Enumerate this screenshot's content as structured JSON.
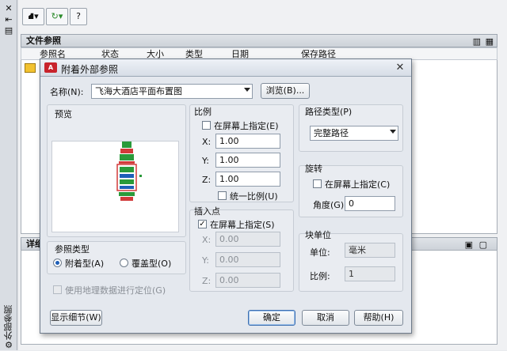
{
  "palette": {
    "title": "外部参照",
    "toolbar": {
      "attach_glyph": "⛘▾",
      "refresh_glyph": "↻▾",
      "help_glyph": "?"
    },
    "file_refs_header": "文件参照",
    "columns": [
      "参照名",
      "状态",
      "大小",
      "类型",
      "日期",
      "保存路径"
    ],
    "details_header": "详细"
  },
  "dialog": {
    "app_badge": "A",
    "title": "附着外部参照",
    "name_label": "名称(N):",
    "name_value": "飞海大酒店平面布置图",
    "browse_label": "浏览(B)...",
    "preview_label": "预览",
    "ref_type": {
      "label": "参照类型",
      "attach_label": "附着型(A)",
      "overlay_label": "覆盖型(O)"
    },
    "geo_label": "使用地理数据进行定位(G)",
    "scale": {
      "label": "比例",
      "onscreen_label": "在屏幕上指定(E)",
      "x_label": "X:",
      "x_value": "1.00",
      "y_label": "Y:",
      "y_value": "1.00",
      "z_label": "Z:",
      "z_value": "1.00",
      "uniform_label": "统一比例(U)"
    },
    "insertion": {
      "label": "插入点",
      "onscreen_label": "在屏幕上指定(S)",
      "x_label": "X:",
      "x_value": "0.00",
      "y_label": "Y:",
      "y_value": "0.00",
      "z_label": "Z:",
      "z_value": "0.00"
    },
    "path_type": {
      "label": "路径类型(P)",
      "value": "完整路径"
    },
    "rotation": {
      "label": "旋转",
      "onscreen_label": "在屏幕上指定(C)",
      "angle_label": "角度(G):",
      "angle_value": "0"
    },
    "block_unit": {
      "label": "块单位",
      "unit_label": "单位:",
      "unit_value": "毫米",
      "scale_label": "比例:",
      "scale_value": "1"
    },
    "details_btn": "显示细节(W)",
    "ok_btn": "确定",
    "cancel_btn": "取消",
    "help_btn": "帮助(H)",
    "close_glyph": "✕"
  }
}
